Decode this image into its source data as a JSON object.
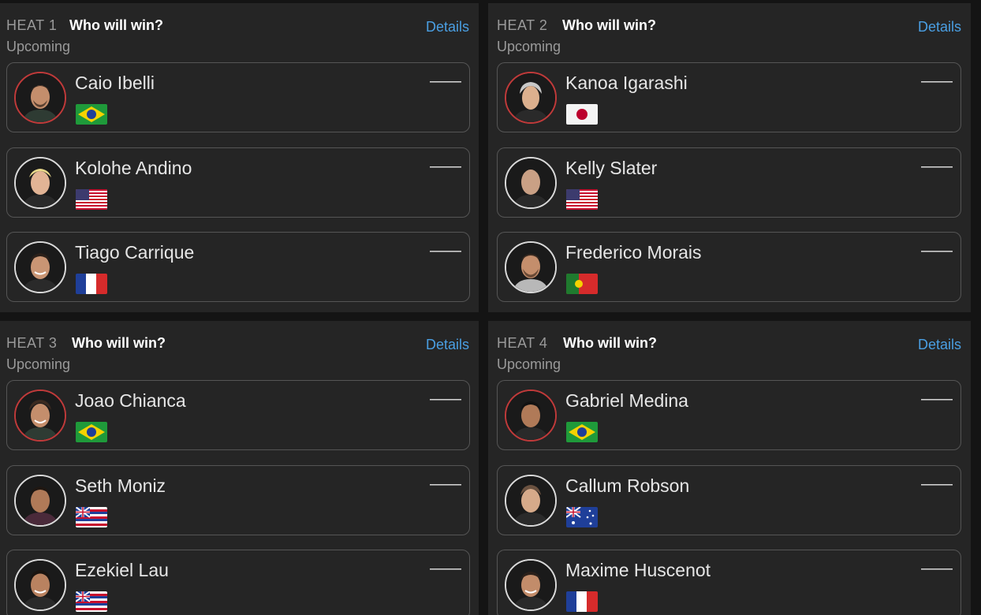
{
  "heats": [
    {
      "number": "HEAT 1",
      "question": "Who will win?",
      "status": "Upcoming",
      "details": "Details",
      "surfers": [
        {
          "name": "Caio Ibelli",
          "country": "brazil-flag",
          "score": "——"
        },
        {
          "name": "Kolohe Andino",
          "country": "usa-flag",
          "score": "——"
        },
        {
          "name": "Tiago Carrique",
          "country": "france-flag",
          "score": "——"
        }
      ]
    },
    {
      "number": "HEAT 2",
      "question": "Who will win?",
      "status": "Upcoming",
      "details": "Details",
      "surfers": [
        {
          "name": "Kanoa Igarashi",
          "country": "japan-flag",
          "score": "——"
        },
        {
          "name": "Kelly Slater",
          "country": "usa-flag",
          "score": "——"
        },
        {
          "name": "Frederico Morais",
          "country": "portugal-flag",
          "score": "——"
        }
      ]
    },
    {
      "number": "HEAT 3",
      "question": "Who will win?",
      "status": "Upcoming",
      "details": "Details",
      "surfers": [
        {
          "name": "Joao Chianca",
          "country": "brazil-flag",
          "score": "——"
        },
        {
          "name": "Seth Moniz",
          "country": "hawaii-flag",
          "score": "——"
        },
        {
          "name": "Ezekiel Lau",
          "country": "hawaii-flag",
          "score": "——"
        }
      ]
    },
    {
      "number": "HEAT 4",
      "question": "Who will win?",
      "status": "Upcoming",
      "details": "Details",
      "surfers": [
        {
          "name": "Gabriel Medina",
          "country": "brazil-flag",
          "score": "——"
        },
        {
          "name": "Callum Robson",
          "country": "australia-flag",
          "score": "——"
        },
        {
          "name": "Maxime Huscenot",
          "country": "france-flag",
          "score": "——"
        }
      ]
    }
  ],
  "colors": {
    "background": "#141414",
    "card": "#252525",
    "link": "#4a9fe3",
    "lead_ring": "#c03a3a"
  }
}
